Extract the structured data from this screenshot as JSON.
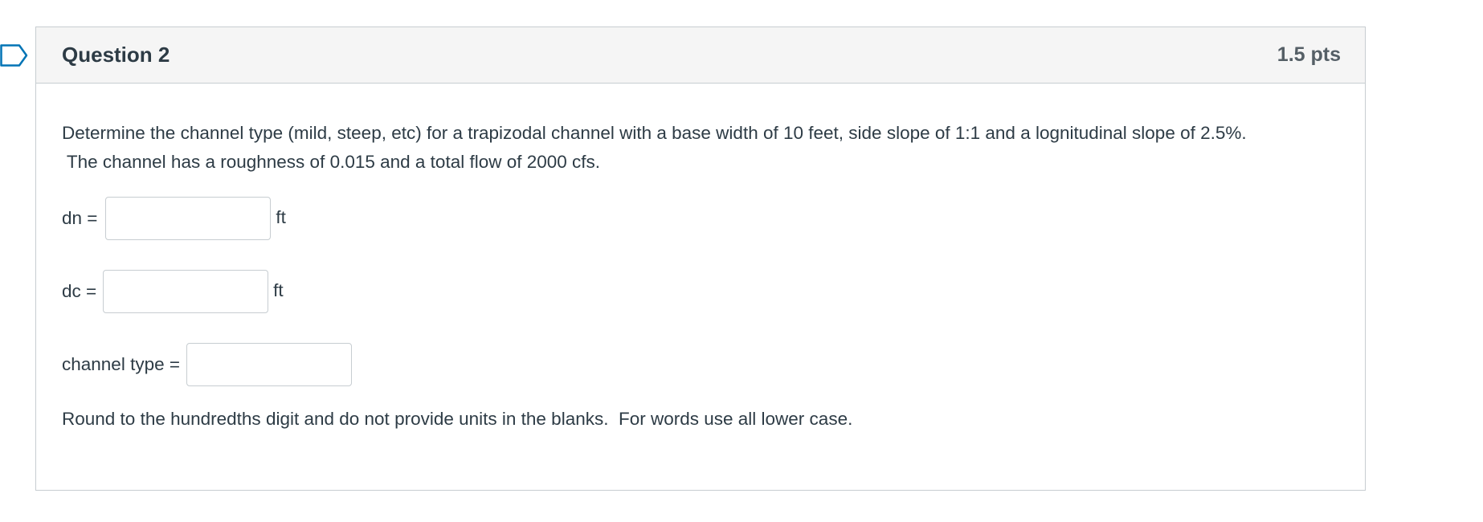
{
  "question": {
    "title": "Question 2",
    "points": "1.5 pts",
    "prompt_line1": "Determine the channel type (mild, steep, etc) for a trapizodal channel with a base width of 10 feet, side slope of 1:1 and a lognitudinal slope of 2.5%.",
    "prompt_line2": " The channel has a roughness of 0.015 and a total flow of 2000 cfs.",
    "answers": [
      {
        "label": "dn =",
        "value": "",
        "unit": "ft"
      },
      {
        "label": "dc =",
        "value": "",
        "unit": "ft"
      },
      {
        "label": "channel type =",
        "value": "",
        "unit": ""
      }
    ],
    "note": "Round to the hundredths digit and do not provide units in the blanks.  For words use all lower case."
  },
  "colors": {
    "flag": "#0374b5",
    "border": "#c7cdd1",
    "header_bg": "#f5f5f5",
    "text": "#2d3b45"
  }
}
